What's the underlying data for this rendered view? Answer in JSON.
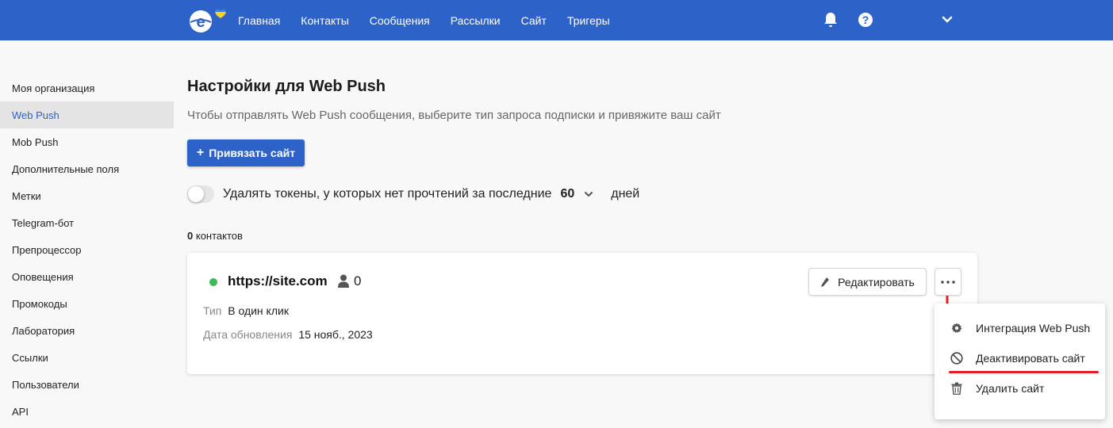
{
  "header": {
    "nav": [
      "Главная",
      "Контакты",
      "Сообщения",
      "Рассылки",
      "Сайт",
      "Тригеры"
    ],
    "icons": [
      "logo-icon",
      "bell-icon",
      "help-icon",
      "chevron-down-icon"
    ],
    "brand_color": "#2d63c8"
  },
  "sidebar": {
    "items": [
      {
        "label": "Моя организация"
      },
      {
        "label": "Web Push",
        "active": true
      },
      {
        "label": "Mob Push"
      },
      {
        "label": "Дополнительные поля"
      },
      {
        "label": "Метки"
      },
      {
        "label": "Telegram-бот"
      },
      {
        "label": "Препроцессор"
      },
      {
        "label": "Оповещения"
      },
      {
        "label": "Промокоды"
      },
      {
        "label": "Лаборатория"
      },
      {
        "label": "Ссылки"
      },
      {
        "label": "Пользователи"
      },
      {
        "label": "API"
      }
    ]
  },
  "main": {
    "title": "Настройки для Web Push",
    "subtitle": "Чтобы отправлять Web Push сообщения, выберите тип запроса подписки и привяжите ваш сайт",
    "bind_button": {
      "icon": "+",
      "label": "Привязать сайт"
    },
    "token_setting": {
      "text": "Удалять токены, у которых нет прочтений за последние",
      "days_value": "60",
      "days_unit": "дней",
      "enabled": false
    },
    "contacts": {
      "count": "0",
      "label": "контактов"
    }
  },
  "site_card": {
    "url": "https://site.com",
    "status_color": "#3cba54",
    "subscribers": "0",
    "type_label": "Тип",
    "type_value": "В один клик",
    "updated_label": "Дата обновления",
    "updated_value": "15 нояб., 2023",
    "edit_label": "Редактировать"
  },
  "dropdown": {
    "items": [
      {
        "label": "Интеграция Web Push",
        "icon": "gear-icon"
      },
      {
        "label": "Деактивировать сайт",
        "icon": "block-icon",
        "highlighted": true
      },
      {
        "label": "Удалить сайт",
        "icon": "trash-icon"
      }
    ],
    "highlight_color": "#e41e26"
  }
}
